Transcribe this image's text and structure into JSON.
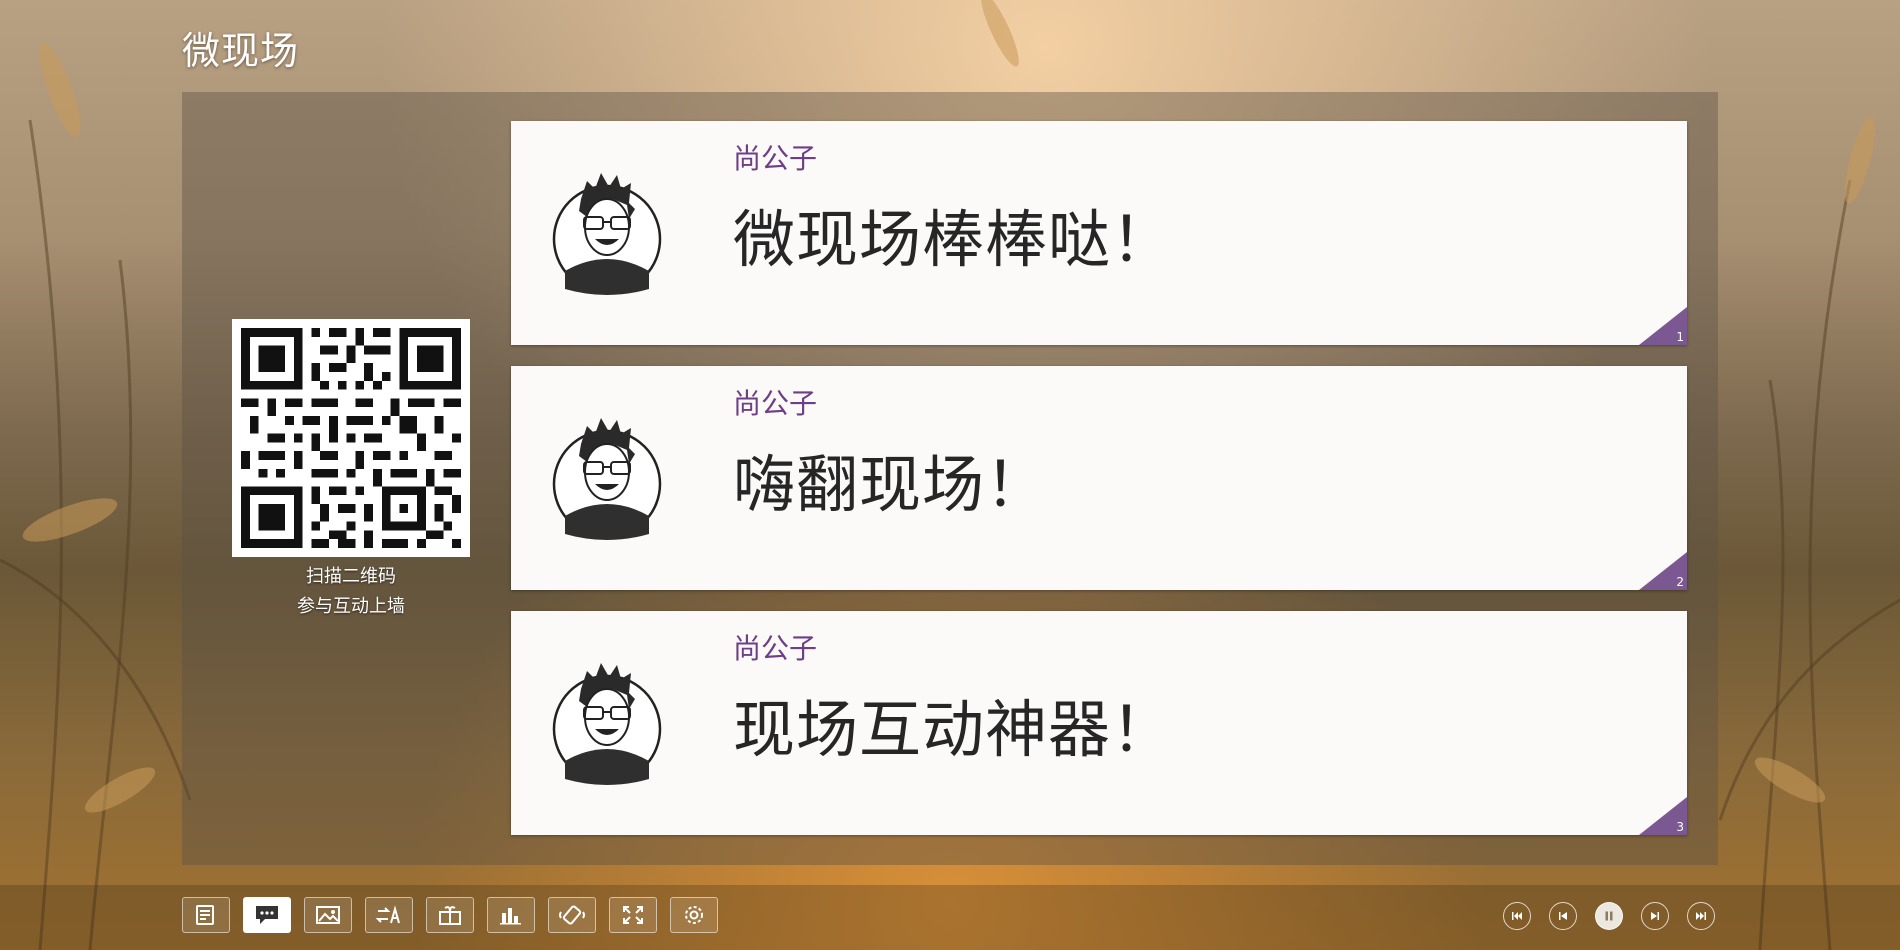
{
  "app": {
    "title": "微现场"
  },
  "qr": {
    "caption_line1": "扫描二维码",
    "caption_line2": "参与互动上墙"
  },
  "messages": [
    {
      "user": "尚公子",
      "text": "微现场棒棒哒！",
      "index": "1"
    },
    {
      "user": "尚公子",
      "text": "嗨翻现场！",
      "index": "2"
    },
    {
      "user": "尚公子",
      "text": "现场互动神器！",
      "index": "3"
    }
  ],
  "toolbar": {
    "buttons": [
      "sign-in-wall-icon",
      "message-wall-icon",
      "photo-wall-icon",
      "lottery-icon",
      "gift-icon",
      "vote-chart-icon",
      "shake-icon",
      "fullscreen-icon",
      "settings-icon"
    ],
    "active": "message-wall-icon"
  },
  "player": {
    "controls": [
      "first-icon",
      "previous-icon",
      "pause-icon",
      "next-icon",
      "last-icon"
    ],
    "state": "playing"
  },
  "colors": {
    "accent": "#7b5891",
    "username": "#6e3f86"
  }
}
